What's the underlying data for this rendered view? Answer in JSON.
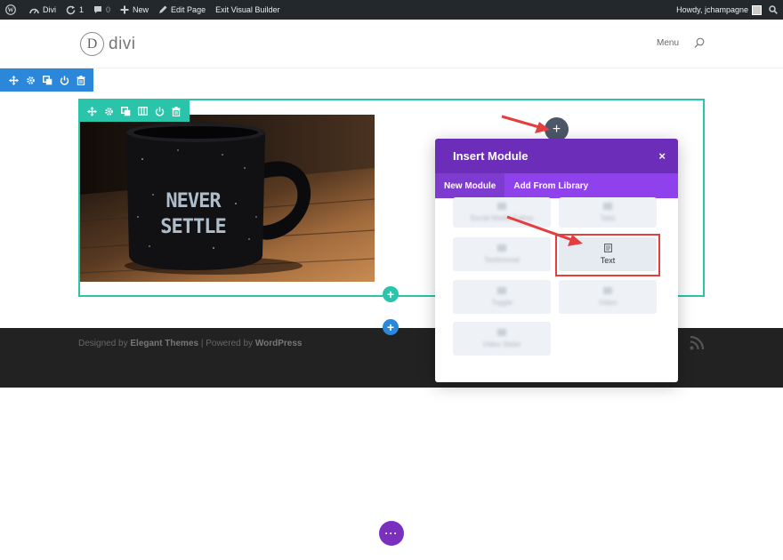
{
  "admin_bar": {
    "site_name": "Divi",
    "updates_count": "1",
    "comments_count": "0",
    "new_label": "New",
    "edit_page_label": "Edit Page",
    "exit_builder_label": "Exit Visual Builder",
    "greeting": "Howdy, jchampagne"
  },
  "header": {
    "logo_letter": "D",
    "logo_text": "divi",
    "menu_label": "Menu"
  },
  "footer": {
    "designed_by_prefix": "Designed by ",
    "designed_by_brand": "Elegant Themes",
    "separator": " | Powered by ",
    "powered_by_brand": "WordPress"
  },
  "image": {
    "mug_print_line1": "NEVER",
    "mug_print_line2": "SETTLE"
  },
  "insert_module": {
    "title": "Insert Module",
    "close_icon": "×",
    "tabs": [
      {
        "label": "New Module",
        "active": true
      },
      {
        "label": "Add From Library",
        "active": false
      }
    ],
    "items": [
      {
        "label": "Social Media Follow",
        "blurred": true
      },
      {
        "label": "Tabs",
        "blurred": true
      },
      {
        "label": "Testimonial",
        "blurred": true
      },
      {
        "label": "Text",
        "blurred": false,
        "highlighted": true
      },
      {
        "label": "Toggle",
        "blurred": true
      },
      {
        "label": "Video",
        "blurred": true
      },
      {
        "label": "Video Slider",
        "blurred": true
      }
    ]
  },
  "buttons": {
    "add_plus": "+",
    "more_dots": "···"
  },
  "colors": {
    "admin_bar": "#23282d",
    "section_blue": "#2b87da",
    "row_teal": "#29c4a9",
    "modal_purple": "#6c2eb9",
    "modal_tab_purple": "#8f42ec",
    "highlight_red": "#e53e3e",
    "footer_dark": "#222222"
  }
}
